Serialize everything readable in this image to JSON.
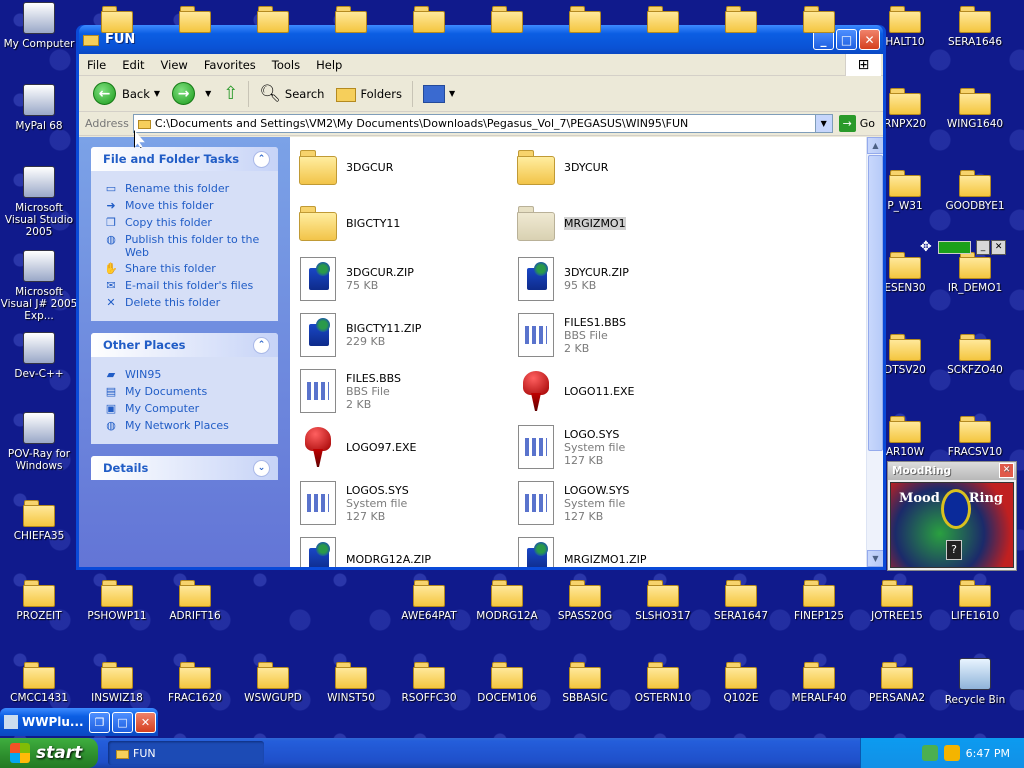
{
  "desktop": {
    "left_icons": [
      {
        "label": "My Computer",
        "icon": "my-computer-icon"
      },
      {
        "label": "MyPal 68",
        "icon": "mypal-icon"
      },
      {
        "label": "Microsoft Visual Studio 2005",
        "icon": "visual-studio-icon"
      },
      {
        "label": "Microsoft Visual J# 2005 Exp...",
        "icon": "vjsharp-icon"
      },
      {
        "label": "Dev-C++",
        "icon": "devcpp-icon"
      },
      {
        "label": "POV-Ray for Windows",
        "icon": "povray-icon"
      },
      {
        "label": "CHIEFA35",
        "icon": "folder-icon"
      }
    ],
    "right_icons": [
      {
        "label": "HALT10"
      },
      {
        "label": "SERA1646"
      },
      {
        "label": "RNPX20"
      },
      {
        "label": "WING1640"
      },
      {
        "label": "P_W31"
      },
      {
        "label": "GOODBYE1"
      },
      {
        "label": "ESEN30"
      },
      {
        "label": "IR_DEMO1"
      },
      {
        "label": "DTSV20"
      },
      {
        "label": "SCKFZO40"
      },
      {
        "label": "AR10W"
      },
      {
        "label": "FRACSV10"
      }
    ],
    "row1": [
      "PROZEIT",
      "PSHOWP11",
      "ADRIFT16",
      "AWE64PAT",
      "MODRG12A",
      "SPASS20G",
      "SLSHO317",
      "SERA1647",
      "FINEP125",
      "JOTREE15",
      "LIFE1610"
    ],
    "row2": [
      "CMCC1431",
      "INSWIZ18",
      "FRAC1620",
      "WSWGUPD",
      "WINST50",
      "RSOFFC30",
      "DOCEM106",
      "SBBASIC",
      "OSTERN10",
      "Q102E",
      "MERALF40",
      "PERSANA2",
      "Recycle Bin"
    ]
  },
  "window": {
    "title": "FUN",
    "menu": [
      "File",
      "Edit",
      "View",
      "Favorites",
      "Tools",
      "Help"
    ],
    "toolbar": {
      "back": "Back",
      "search": "Search",
      "folders": "Folders"
    },
    "address": {
      "label": "Address",
      "path": "C:\\Documents and Settings\\VM2\\My Documents\\Downloads\\Pegasus_Vol_7\\PEGASUS\\WIN95\\FUN",
      "go": "Go"
    },
    "tasks": {
      "file_folder_title": "File and Folder Tasks",
      "file_folder_items": [
        {
          "label": "Rename this folder",
          "icon": "rename-icon"
        },
        {
          "label": "Move this folder",
          "icon": "move-icon"
        },
        {
          "label": "Copy this folder",
          "icon": "copy-icon"
        },
        {
          "label": "Publish this folder to the Web",
          "icon": "publish-icon"
        },
        {
          "label": "Share this folder",
          "icon": "share-icon"
        },
        {
          "label": "E-mail this folder's files",
          "icon": "email-icon"
        },
        {
          "label": "Delete this folder",
          "icon": "delete-icon"
        }
      ],
      "other_places_title": "Other Places",
      "other_places_items": [
        {
          "label": "WIN95",
          "icon": "folder-icon"
        },
        {
          "label": "My Documents",
          "icon": "my-documents-icon"
        },
        {
          "label": "My Computer",
          "icon": "my-computer-icon"
        },
        {
          "label": "My Network Places",
          "icon": "network-icon"
        }
      ],
      "details_title": "Details"
    },
    "files": [
      {
        "name": "3DGCUR",
        "type": "",
        "size": "",
        "kind": "folder"
      },
      {
        "name": "3DYCUR",
        "type": "",
        "size": "",
        "kind": "folder"
      },
      {
        "name": "BIGCTY11",
        "type": "",
        "size": "",
        "kind": "folder"
      },
      {
        "name": "MRGIZMO1",
        "type": "",
        "size": "",
        "kind": "folder-selected"
      },
      {
        "name": "3DGCUR.ZIP",
        "type": "",
        "size": "75 KB",
        "kind": "zip"
      },
      {
        "name": "3DYCUR.ZIP",
        "type": "",
        "size": "95 KB",
        "kind": "zip"
      },
      {
        "name": "BIGCTY11.ZIP",
        "type": "",
        "size": "229 KB",
        "kind": "zip"
      },
      {
        "name": "FILES1.BBS",
        "type": "BBS File",
        "size": "2 KB",
        "kind": "doc"
      },
      {
        "name": "FILES.BBS",
        "type": "BBS File",
        "size": "2 KB",
        "kind": "doc"
      },
      {
        "name": "LOGO11.EXE",
        "type": "",
        "size": "",
        "kind": "exe"
      },
      {
        "name": "LOGO97.EXE",
        "type": "",
        "size": "",
        "kind": "exe"
      },
      {
        "name": "LOGO.SYS",
        "type": "System file",
        "size": "127 KB",
        "kind": "doc"
      },
      {
        "name": "LOGOS.SYS",
        "type": "System file",
        "size": "127 KB",
        "kind": "doc"
      },
      {
        "name": "LOGOW.SYS",
        "type": "System file",
        "size": "127 KB",
        "kind": "doc"
      },
      {
        "name": "MODRG12A.ZIP",
        "type": "",
        "size": "",
        "kind": "zip"
      },
      {
        "name": "MRGIZMO1.ZIP",
        "type": "",
        "size": "",
        "kind": "zip"
      }
    ]
  },
  "taskbar": {
    "start": "start",
    "task_item": "FUN",
    "clock": "6:47 PM"
  },
  "wwplus": {
    "title": "WWPlu..."
  },
  "moodring": {
    "title": "MoodRing",
    "word_left": "Mood",
    "word_right": "Ring",
    "q": "?"
  },
  "colors": {
    "desktop": "#101a8c",
    "titlebar": "#0a52d4",
    "taskpane": "#6f8de0",
    "start": "#2d8d2d"
  }
}
